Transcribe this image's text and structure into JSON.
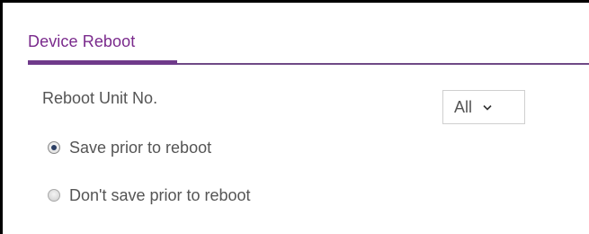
{
  "panel": {
    "title": "Device Reboot",
    "accent_color": "#7a2a8c"
  },
  "reboot_unit": {
    "label": "Reboot Unit No.",
    "selected_value": "All"
  },
  "save_options": [
    {
      "label": "Save prior to reboot",
      "checked": true
    },
    {
      "label": "Don't save prior to reboot",
      "checked": false
    }
  ]
}
